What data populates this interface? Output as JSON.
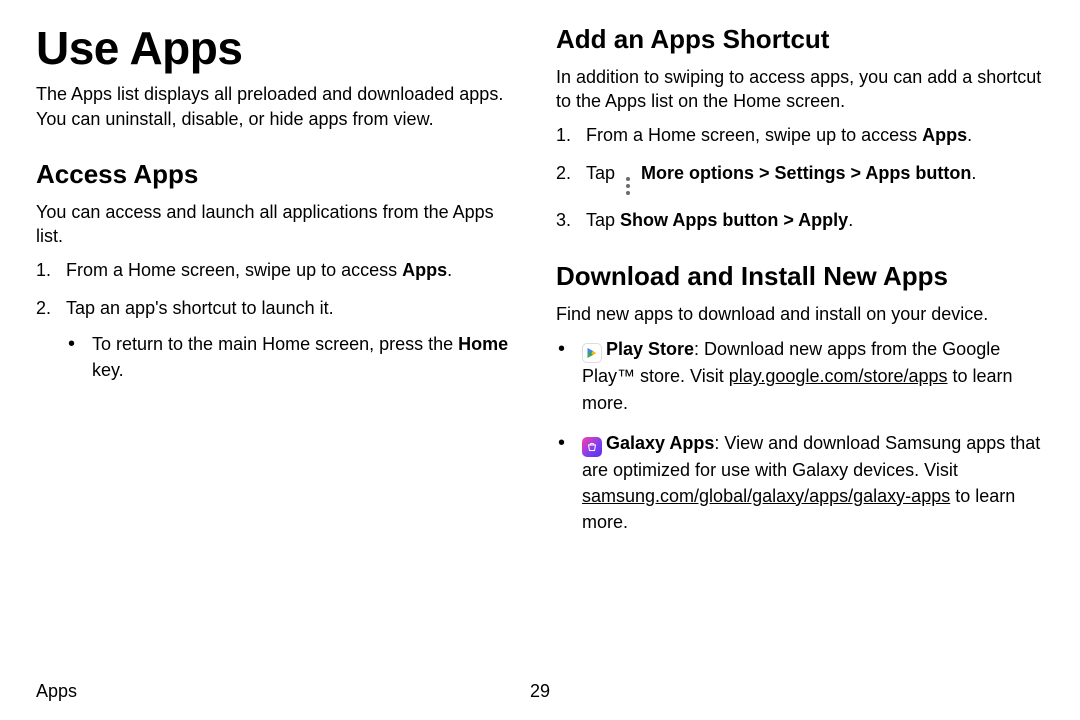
{
  "footer": {
    "section": "Apps",
    "page": "29"
  },
  "left": {
    "title": "Use Apps",
    "intro": "The Apps list displays all preloaded and downloaded apps. You can uninstall, disable, or hide apps from view.",
    "access": {
      "heading": "Access Apps",
      "intro": "You can access and launch all applications from the Apps list.",
      "step1_a": "From a Home screen, swipe up to access ",
      "step1_b": "Apps",
      "step1_c": ".",
      "step2": "Tap an app's shortcut to launch it.",
      "sub1_a": "To return to the main Home screen, press the ",
      "sub1_b": "Home",
      "sub1_c": " key."
    }
  },
  "right": {
    "shortcut": {
      "heading": "Add an Apps Shortcut",
      "intro": "In addition to swiping to access apps, you can add a shortcut to the Apps list on the Home screen.",
      "step1_a": "From a Home screen, swipe up to access ",
      "step1_b": "Apps",
      "step1_c": ".",
      "step2_a": "Tap ",
      "step2_b": "More options > Settings > Apps button",
      "step2_c": ".",
      "step3_a": "Tap ",
      "step3_b": "Show Apps button > Apply",
      "step3_c": "."
    },
    "download": {
      "heading": "Download and Install New Apps",
      "intro": "Find new apps to download and install on your device.",
      "play_label": "Play Store",
      "play_a": ": Download new apps from the Google Play™ store. Visit ",
      "play_link": "play.google.com/store/apps",
      "play_b": " to learn more.",
      "galaxy_label": "Galaxy Apps",
      "galaxy_a": ": View and download Samsung apps that are optimized for use with Galaxy devices. Visit ",
      "galaxy_link": "samsung.com/global/galaxy/apps/galaxy-apps",
      "galaxy_b": " to learn more."
    }
  }
}
